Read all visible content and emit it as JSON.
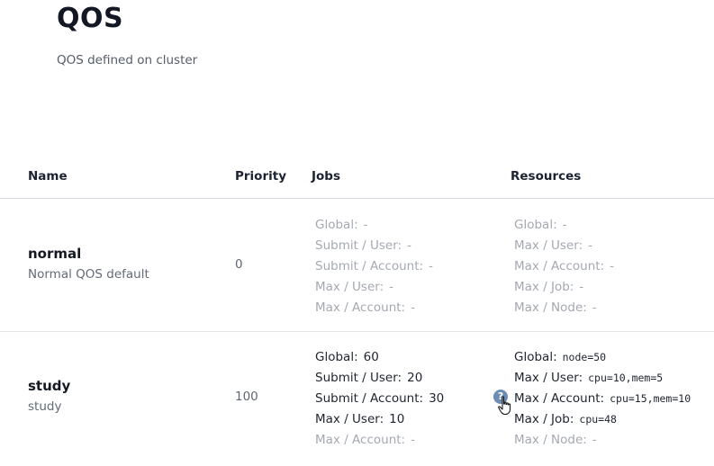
{
  "page": {
    "title": "QOS",
    "subtitle": "QOS defined on cluster"
  },
  "table": {
    "headers": {
      "name": "Name",
      "priority": "Priority",
      "jobs": "Jobs",
      "resources": "Resources"
    },
    "rows": [
      {
        "name": "normal",
        "description": "Normal QOS default",
        "priority": "0",
        "jobs": [
          {
            "label": "Global:",
            "value": "-",
            "set": false
          },
          {
            "label": "Submit / User:",
            "value": "-",
            "set": false
          },
          {
            "label": "Submit / Account:",
            "value": "-",
            "set": false
          },
          {
            "label": "Max / User:",
            "value": "-",
            "set": false
          },
          {
            "label": "Max / Account:",
            "value": "-",
            "set": false
          }
        ],
        "resources": [
          {
            "label": "Global:",
            "value": "-",
            "set": false
          },
          {
            "label": "Max / User:",
            "value": "-",
            "set": false
          },
          {
            "label": "Max / Account:",
            "value": "-",
            "set": false
          },
          {
            "label": "Max / Job:",
            "value": "-",
            "set": false
          },
          {
            "label": "Max / Node:",
            "value": "-",
            "set": false
          }
        ]
      },
      {
        "name": "study",
        "description": "study",
        "priority": "100",
        "jobs": [
          {
            "label": "Global:",
            "value": "60",
            "set": true
          },
          {
            "label": "Submit / User:",
            "value": "20",
            "set": true
          },
          {
            "label": "Submit / Account:",
            "value": "30",
            "set": true
          },
          {
            "label": "Max / User:",
            "value": "10",
            "set": true
          },
          {
            "label": "Max / Account:",
            "value": "-",
            "set": false
          }
        ],
        "resources": [
          {
            "label": "Global:",
            "value": "node=50",
            "set": true
          },
          {
            "label": "Max / User:",
            "value": "cpu=10,mem=5",
            "set": true
          },
          {
            "label": "Max / Account:",
            "value": "cpu=15,mem=10",
            "set": true
          },
          {
            "label": "Max / Job:",
            "value": "cpu=48",
            "set": true
          },
          {
            "label": "Max / Node:",
            "value": "-",
            "set": false
          }
        ]
      }
    ]
  },
  "icons": {
    "help": "help-circle-icon",
    "cursor": "hand-pointer-cursor",
    "help_glyph": "?",
    "help_color": "#6d8db3"
  }
}
